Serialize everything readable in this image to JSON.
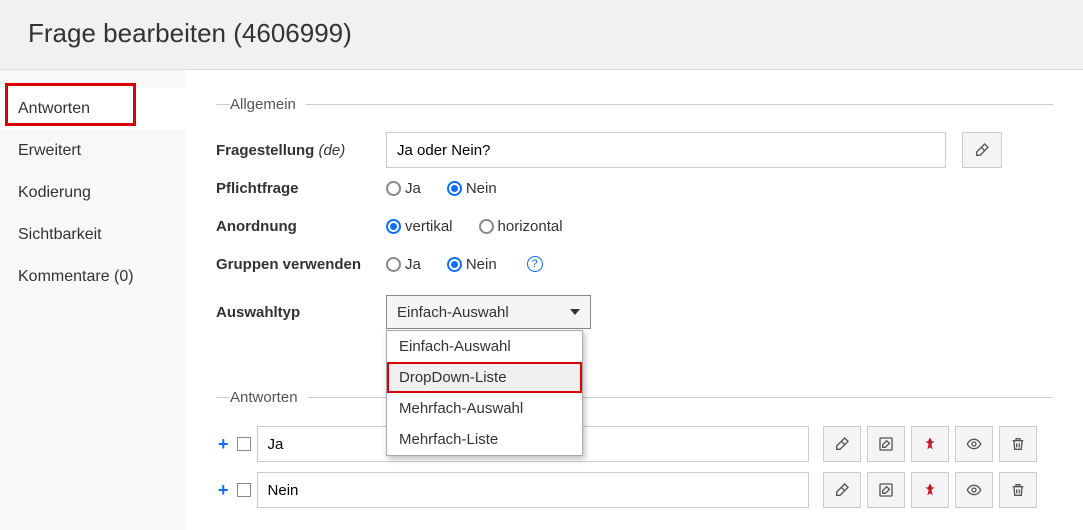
{
  "header": {
    "title": "Frage bearbeiten (4606999)"
  },
  "sidebar": {
    "items": [
      {
        "label": "Antworten"
      },
      {
        "label": "Erweitert"
      },
      {
        "label": "Kodierung"
      },
      {
        "label": "Sichtbarkeit"
      },
      {
        "label": "Kommentare (0)"
      }
    ]
  },
  "general": {
    "legend": "Allgemein",
    "question_label": "Fragestellung",
    "lang_suffix": "(de)",
    "question_value": "Ja oder Nein?",
    "mandatory_label": "Pflichtfrage",
    "mandatory_yes": "Ja",
    "mandatory_no": "Nein",
    "orientation_label": "Anordnung",
    "orientation_vertical": "vertikal",
    "orientation_horizontal": "horizontal",
    "groups_label": "Gruppen verwenden",
    "groups_yes": "Ja",
    "groups_no": "Nein",
    "selecttype_label": "Auswahltyp",
    "selecttype_value": "Einfach-Auswahl",
    "selecttype_options": [
      "Einfach-Auswahl",
      "DropDown-Liste",
      "Mehrfach-Auswahl",
      "Mehrfach-Liste"
    ]
  },
  "answers": {
    "legend": "Antworten",
    "rows": [
      {
        "value": "Ja"
      },
      {
        "value": "Nein"
      }
    ]
  },
  "icons": {
    "plus": "+"
  }
}
